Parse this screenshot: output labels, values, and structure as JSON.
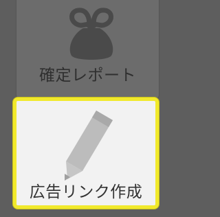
{
  "menu": {
    "tiles": [
      {
        "label": "確定レポート",
        "icon": "purse-icon",
        "state": "disabled"
      },
      {
        "label": "広告リンク作成",
        "icon": "pencil-icon",
        "state": "selected"
      }
    ]
  },
  "colors": {
    "background": "#5e5e5e",
    "disabled_tile": "#6c6c6c",
    "selected_tile": "#f2f2f2",
    "highlight_border": "#f1e92c",
    "icon_gray": "#bcbcbc",
    "disabled_icon": "#4a4a4a"
  }
}
